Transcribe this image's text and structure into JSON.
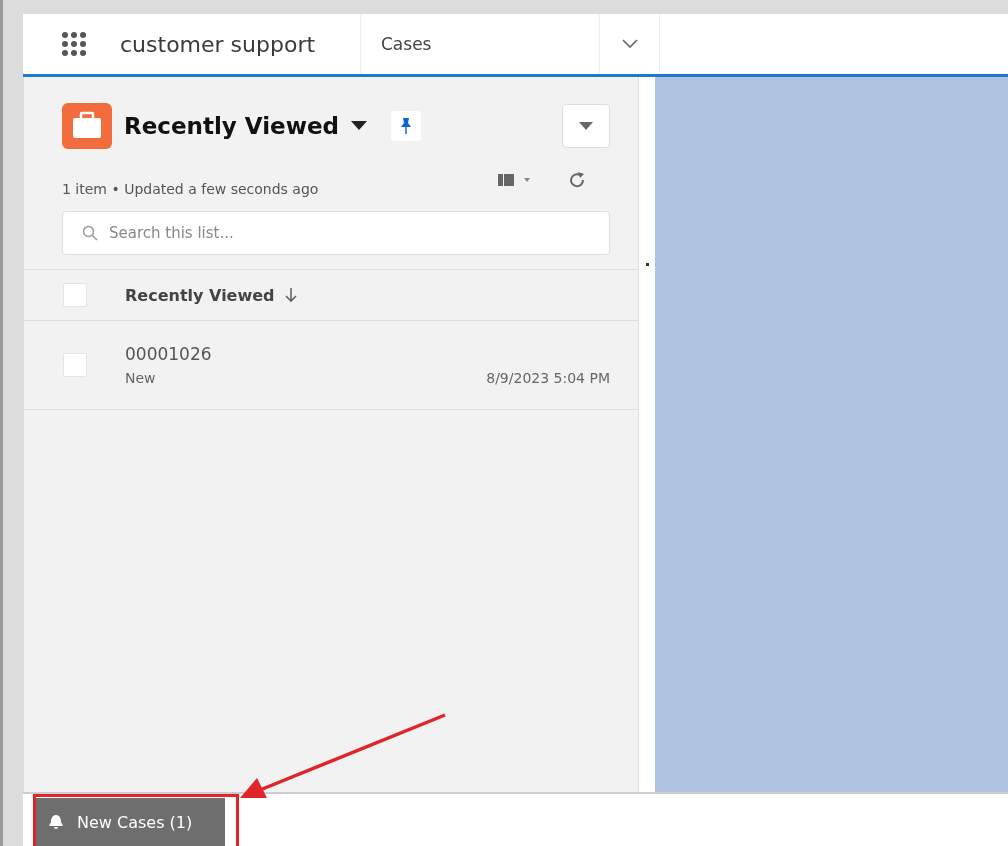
{
  "nav": {
    "app_name": "customer support",
    "tab": "Cases"
  },
  "list_view": {
    "title": "Recently Viewed",
    "pinned": true,
    "status": "1 item • Updated a few seconds ago",
    "search": {
      "placeholder": "Search this list..."
    },
    "column": {
      "label": "Recently Viewed",
      "checked": false
    },
    "rows": [
      {
        "case_number": "00001026",
        "status": "New",
        "date": "8/9/2023 5:04 PM",
        "checked": false
      }
    ]
  },
  "utility_bar": {
    "label": "New Cases (1)"
  }
}
